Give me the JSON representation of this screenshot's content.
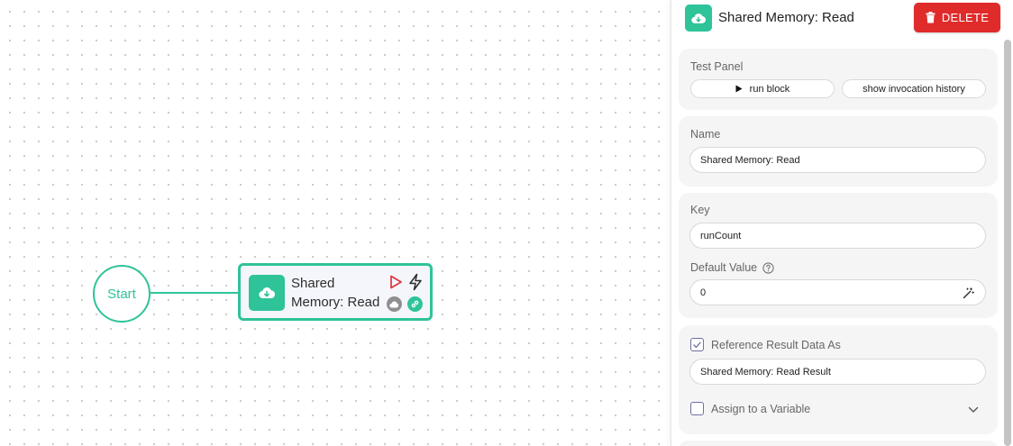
{
  "canvas": {
    "start_label": "Start",
    "block_title": "Shared Memory: Read"
  },
  "panel": {
    "header_title": "Shared Memory: Read",
    "delete_label": "DELETE",
    "test_panel": {
      "label": "Test Panel",
      "run_block_label": "run block",
      "history_label": "show invocation history"
    },
    "name": {
      "label": "Name",
      "value": "Shared Memory: Read"
    },
    "key": {
      "label": "Key",
      "value": "runCount"
    },
    "default_value": {
      "label": "Default Value",
      "value": "0"
    },
    "reference": {
      "label": "Reference Result Data As",
      "checked": true,
      "value": "Shared Memory: Read Result"
    },
    "assign_variable": {
      "label": "Assign to a Variable",
      "checked": false
    }
  },
  "colors": {
    "accent": "#2fc39a",
    "danger": "#e02b2b",
    "run_icon": "#e0333a"
  },
  "icons": [
    "cloud-download-icon",
    "play-icon",
    "lightning-icon",
    "trash-icon",
    "help-circle-icon",
    "magic-wand-icon",
    "chevron-down-icon",
    "link-icon",
    "checkmark-icon"
  ]
}
